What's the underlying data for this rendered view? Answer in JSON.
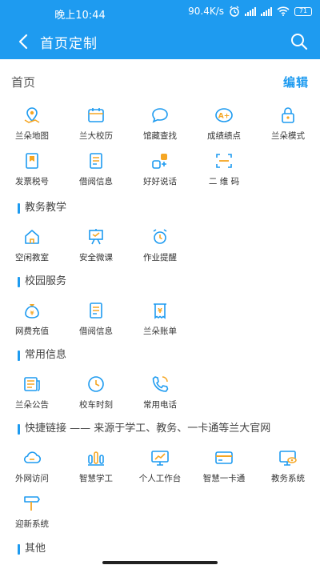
{
  "status_bar": {
    "time": "晚上10:44",
    "speed": "90.4K/s",
    "battery": "71"
  },
  "app_bar": {
    "title": "首页定制"
  },
  "home": {
    "label": "首页",
    "edit": "编辑"
  },
  "home_items": [
    {
      "label": "兰朵地图",
      "icon": "map-pin-icon"
    },
    {
      "label": "兰大校历",
      "icon": "calendar-icon"
    },
    {
      "label": "馆藏查找",
      "icon": "chat-bubble-icon"
    },
    {
      "label": "成绩绩点",
      "icon": "grade-a-plus-icon"
    },
    {
      "label": "兰朵模式",
      "icon": "lock-icon"
    },
    {
      "label": "发票税号",
      "icon": "bookmark-icon"
    },
    {
      "label": "借阅信息",
      "icon": "book-icon"
    },
    {
      "label": "好好说话",
      "icon": "shapes-icon"
    },
    {
      "label": "二 维 码",
      "icon": "scan-icon"
    }
  ],
  "sections": [
    {
      "title": "教务教学",
      "items": [
        {
          "label": "空闲教室",
          "icon": "house-icon"
        },
        {
          "label": "安全微课",
          "icon": "easel-icon"
        },
        {
          "label": "作业提醒",
          "icon": "alarm-clock-icon"
        }
      ]
    },
    {
      "title": "校园服务",
      "items": [
        {
          "label": "网费充值",
          "icon": "money-bag-icon"
        },
        {
          "label": "借阅信息",
          "icon": "book-icon"
        },
        {
          "label": "兰朵账单",
          "icon": "receipt-icon"
        }
      ]
    },
    {
      "title": "常用信息",
      "items": [
        {
          "label": "兰朵公告",
          "icon": "newspaper-icon"
        },
        {
          "label": "校车时刻",
          "icon": "clock-icon"
        },
        {
          "label": "常用电话",
          "icon": "phone-icon"
        }
      ]
    },
    {
      "title": "快捷链接 —— 来源于学工、教务、一卡通等兰大官网",
      "items": [
        {
          "label": "外网访问",
          "icon": "cloud-icon"
        },
        {
          "label": "智慧学工",
          "icon": "bar-chart-icon"
        },
        {
          "label": "个人工作台",
          "icon": "monitor-chart-icon"
        },
        {
          "label": "智慧一卡通",
          "icon": "card-icon"
        },
        {
          "label": "教务系统",
          "icon": "monitor-eye-icon"
        },
        {
          "label": "迎新系统",
          "icon": "signpost-icon"
        }
      ]
    },
    {
      "title": "其他",
      "items": []
    }
  ],
  "colors": {
    "primary": "#1e9bf0",
    "accent": "#f5a623"
  }
}
